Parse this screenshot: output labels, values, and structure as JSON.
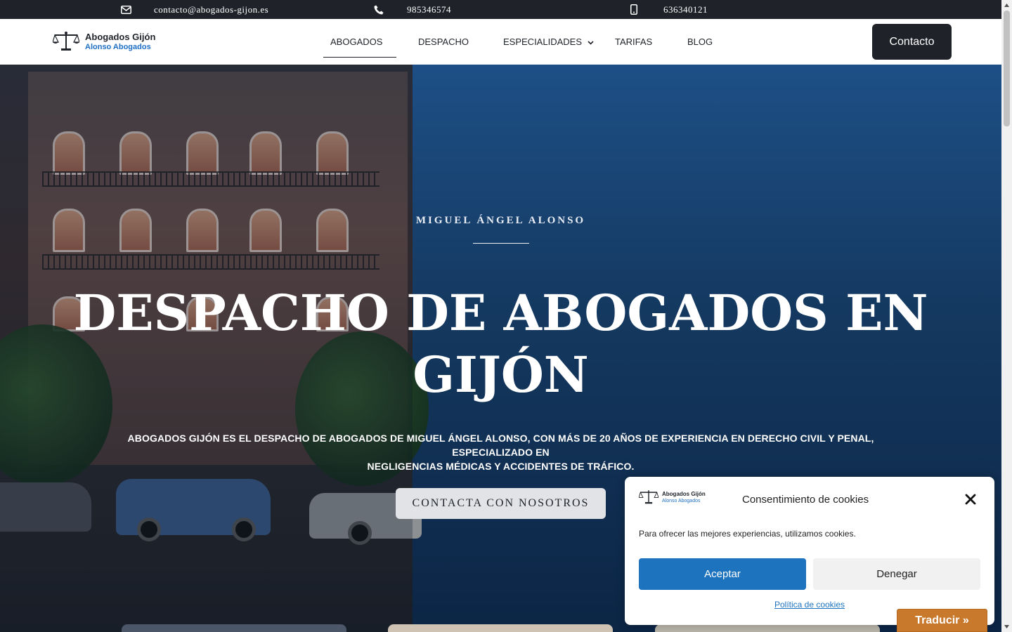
{
  "topbar": {
    "email": "contacto@abogados-gijon.es",
    "email_icon": "envelope-icon",
    "phone": "985346574",
    "phone_icon": "phone-icon",
    "mobile": "636340121",
    "mobile_icon": "mobile-icon"
  },
  "header": {
    "logo_line1": "Abogados Gijón",
    "logo_line2": "Alonso Abogados",
    "logo_icon": "scales-of-justice-icon",
    "nav": [
      {
        "label": "ABOGADOS",
        "active": true
      },
      {
        "label": "DESPACHO"
      },
      {
        "label": "ESPECIALIDADES",
        "dropdown": true
      },
      {
        "label": "TARIFAS"
      },
      {
        "label": "BLOG"
      }
    ],
    "contact_label": "Contacto"
  },
  "hero": {
    "subtitle": "MIGUEL ÁNGEL ALONSO",
    "title_line1": "DESPACHO DE ABOGADOS EN",
    "title_line2": "GIJÓN",
    "description_line1": "ABOGADOS GIJÓN ES EL DESPACHO DE ABOGADOS DE MIGUEL ÁNGEL ALONSO, CON MÁS DE 20 AÑOS DE EXPERIENCIA EN DERECHO CIVIL Y PENAL, ESPECIALIZADO EN",
    "description_line2": "NEGLIGENCIAS MÉDICAS Y ACCIDENTES DE TRÁFICO.",
    "cta_label": "CONTACTA CON NOSOTROS"
  },
  "cookie": {
    "logo_line1": "Abogados Gijón",
    "logo_line2": "Alonso Abogados",
    "title": "Consentimiento de cookies",
    "text": "Para ofrecer las mejores experiencias, utilizamos cookies.",
    "accept_label": "Aceptar",
    "deny_label": "Denegar",
    "policy_label": "Política de cookies",
    "close_icon": "close-icon"
  },
  "translate_label": "Traducir »",
  "colors": {
    "dark": "#1f2329",
    "accent_blue": "#1e73be",
    "translate_orange": "#c9792b",
    "hero_blue": "#14385f"
  }
}
